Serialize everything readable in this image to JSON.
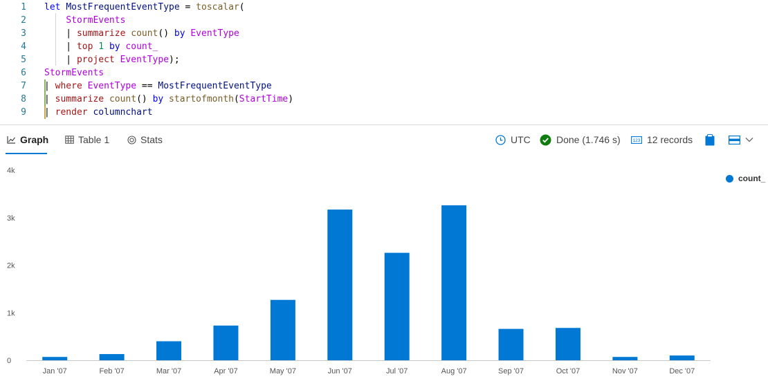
{
  "editor": {
    "lines": [
      {
        "num": "1",
        "tokens": [
          [
            "kw",
            "let "
          ],
          [
            "id",
            "MostFrequentEventType"
          ],
          [
            "p",
            " = "
          ],
          [
            "fn",
            "toscalar"
          ],
          [
            "p",
            "("
          ]
        ]
      },
      {
        "num": "2",
        "tokens": [
          [
            "p",
            "    "
          ],
          [
            "tbl",
            "StormEvents"
          ]
        ]
      },
      {
        "num": "3",
        "tokens": [
          [
            "p",
            "    | "
          ],
          [
            "op",
            "summarize "
          ],
          [
            "fn",
            "count"
          ],
          [
            "p",
            "() "
          ],
          [
            "kw",
            "by "
          ],
          [
            "tbl",
            "EventType"
          ]
        ]
      },
      {
        "num": "4",
        "tokens": [
          [
            "p",
            "    | "
          ],
          [
            "op",
            "top "
          ],
          [
            "num",
            "1 "
          ],
          [
            "kw",
            "by "
          ],
          [
            "tbl",
            "count_"
          ]
        ]
      },
      {
        "num": "5",
        "tokens": [
          [
            "p",
            "    | "
          ],
          [
            "op",
            "project "
          ],
          [
            "tbl",
            "EventType"
          ],
          [
            "p",
            ");"
          ]
        ]
      },
      {
        "num": "6",
        "tokens": [
          [
            "tbl",
            "StormEvents"
          ]
        ]
      },
      {
        "num": "7",
        "tokens": [
          [
            "p",
            "| "
          ],
          [
            "op",
            "where "
          ],
          [
            "tbl",
            "EventType"
          ],
          [
            "p",
            " == "
          ],
          [
            "id",
            "MostFrequentEventType"
          ]
        ]
      },
      {
        "num": "8",
        "tokens": [
          [
            "p",
            "| "
          ],
          [
            "op",
            "summarize "
          ],
          [
            "fn",
            "count"
          ],
          [
            "p",
            "() "
          ],
          [
            "kw",
            "by "
          ],
          [
            "fn",
            "startofmonth"
          ],
          [
            "p",
            "("
          ],
          [
            "tbl",
            "StartTime"
          ],
          [
            "p",
            ")"
          ]
        ]
      },
      {
        "num": "9",
        "tokens": [
          [
            "p",
            "| "
          ],
          [
            "op",
            "render "
          ],
          [
            "id",
            "columnchart"
          ]
        ]
      }
    ]
  },
  "toolbar": {
    "tabs": [
      {
        "label": "Graph",
        "icon": "line-chart-icon"
      },
      {
        "label": "Table 1",
        "icon": "table-icon"
      },
      {
        "label": "Stats",
        "icon": "stats-icon"
      }
    ],
    "timezone": "UTC",
    "status": "Done (1.746 s)",
    "records": "12 records",
    "accent": "#0078d4",
    "done_color": "#107c10"
  },
  "chart_data": {
    "type": "bar",
    "categories": [
      "Jan '07",
      "Feb '07",
      "Mar '07",
      "Apr '07",
      "May '07",
      "Jun '07",
      "Jul '07",
      "Aug '07",
      "Sep '07",
      "Oct '07",
      "Nov '07",
      "Dec '07"
    ],
    "series": [
      {
        "name": "count_",
        "values": [
          70,
          130,
          400,
          730,
          1270,
          3170,
          2260,
          3260,
          660,
          680,
          70,
          100
        ],
        "color": "#0078d4"
      }
    ],
    "ylim": [
      0,
      4000
    ],
    "yticks": [
      0,
      1000,
      2000,
      3000,
      4000
    ],
    "ytick_labels": [
      "0",
      "1k",
      "2k",
      "3k",
      "4k"
    ],
    "legend": "top-right",
    "grid": false
  }
}
